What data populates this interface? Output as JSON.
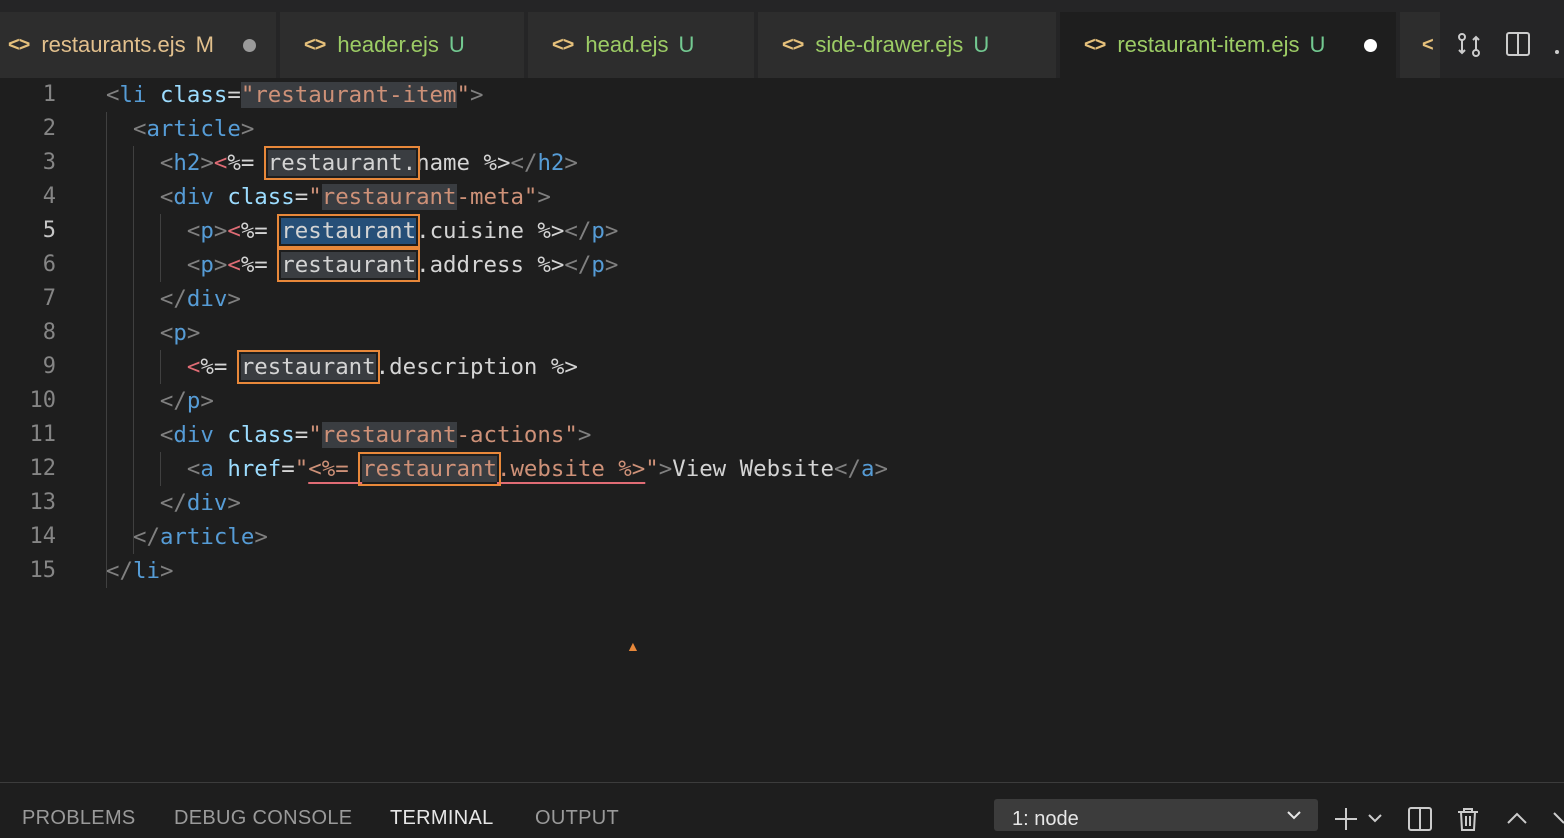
{
  "tabs": [
    {
      "name": "restaurants.ejs",
      "badge": "M",
      "icon": "code-bracket-icon",
      "dirty": true
    },
    {
      "name": "header.ejs",
      "badge": "U",
      "icon": "code-bracket-icon"
    },
    {
      "name": "head.ejs",
      "badge": "U",
      "icon": "code-bracket-icon"
    },
    {
      "name": "side-drawer.ejs",
      "badge": "U",
      "icon": "code-bracket-icon"
    },
    {
      "name": "restaurant-item.ejs",
      "badge": "U",
      "icon": "code-bracket-icon",
      "active": true,
      "dirty": true
    }
  ],
  "tab_icon_glyph": "<>",
  "tab_overflow_glyph": "<",
  "actions": {
    "compare": "compare-changes-icon",
    "split": "split-editor-icon",
    "more": "more-actions-icon"
  },
  "editor": {
    "current_line": 5,
    "line_numbers": [
      "1",
      "2",
      "3",
      "4",
      "5",
      "6",
      "7",
      "8",
      "9",
      "10",
      "11",
      "12",
      "13",
      "14",
      "15"
    ],
    "lines": [
      [
        [
          "tg",
          "<"
        ],
        [
          "tn",
          "li"
        ],
        [
          "tx",
          " "
        ],
        [
          "at",
          "class"
        ],
        [
          "tx",
          "="
        ],
        [
          "st hl",
          "\""
        ],
        [
          "st hl",
          "restaurant-item"
        ],
        [
          "st",
          "\""
        ],
        [
          "tg",
          ">"
        ]
      ],
      [
        [
          "tx",
          "  "
        ],
        [
          "tg",
          "<"
        ],
        [
          "tn",
          "article"
        ],
        [
          "tg",
          ">"
        ]
      ],
      [
        [
          "tx",
          "    "
        ],
        [
          "tg",
          "<"
        ],
        [
          "tn",
          "h2"
        ],
        [
          "tg",
          ">"
        ],
        [
          "ej",
          "<"
        ],
        [
          "tx",
          "%= "
        ],
        [
          "tx hl box",
          "restaurant."
        ],
        [
          "tx",
          "name %>"
        ],
        [
          "tg",
          "</"
        ],
        [
          "tn",
          "h2"
        ],
        [
          "tg",
          ">"
        ]
      ],
      [
        [
          "tx",
          "    "
        ],
        [
          "tg",
          "<"
        ],
        [
          "tn",
          "div"
        ],
        [
          "tx",
          " "
        ],
        [
          "at",
          "class"
        ],
        [
          "tx",
          "="
        ],
        [
          "st",
          "\""
        ],
        [
          "st hl",
          "restaurant"
        ],
        [
          "st",
          "-meta\""
        ],
        [
          "tg",
          ">"
        ]
      ],
      [
        [
          "tx",
          "      "
        ],
        [
          "tg",
          "<"
        ],
        [
          "tn",
          "p"
        ],
        [
          "tg",
          ">"
        ],
        [
          "ej",
          "<"
        ],
        [
          "tx",
          "%= "
        ],
        [
          "tx sel box",
          "restaurant"
        ],
        [
          "tx",
          ".cuisine %>"
        ],
        [
          "tg",
          "</"
        ],
        [
          "tn",
          "p"
        ],
        [
          "tg",
          ">"
        ]
      ],
      [
        [
          "tx",
          "      "
        ],
        [
          "tg",
          "<"
        ],
        [
          "tn",
          "p"
        ],
        [
          "tg",
          ">"
        ],
        [
          "ej",
          "<"
        ],
        [
          "tx",
          "%= "
        ],
        [
          "tx hl box",
          "restaurant"
        ],
        [
          "tx",
          ".address %>"
        ],
        [
          "tg",
          "</"
        ],
        [
          "tn",
          "p"
        ],
        [
          "tg",
          ">"
        ]
      ],
      [
        [
          "tx",
          "    "
        ],
        [
          "tg",
          "</"
        ],
        [
          "tn",
          "div"
        ],
        [
          "tg",
          ">"
        ]
      ],
      [
        [
          "tx",
          "    "
        ],
        [
          "tg",
          "<"
        ],
        [
          "tn",
          "p"
        ],
        [
          "tg",
          ">"
        ]
      ],
      [
        [
          "tx",
          "      "
        ],
        [
          "ej",
          "<"
        ],
        [
          "tx",
          "%= "
        ],
        [
          "tx hl box",
          "restaurant"
        ],
        [
          "tx",
          ".description %>"
        ]
      ],
      [
        [
          "tx",
          "    "
        ],
        [
          "tg",
          "</"
        ],
        [
          "tn",
          "p"
        ],
        [
          "tg",
          ">"
        ]
      ],
      [
        [
          "tx",
          "    "
        ],
        [
          "tg",
          "<"
        ],
        [
          "tn",
          "div"
        ],
        [
          "tx",
          " "
        ],
        [
          "at",
          "class"
        ],
        [
          "tx",
          "="
        ],
        [
          "st",
          "\""
        ],
        [
          "st hl",
          "restaurant"
        ],
        [
          "st",
          "-actions\""
        ],
        [
          "tg",
          ">"
        ]
      ],
      [
        [
          "tx",
          "      "
        ],
        [
          "tg",
          "<"
        ],
        [
          "tn",
          "a"
        ],
        [
          "tx",
          " "
        ],
        [
          "at",
          "href"
        ],
        [
          "tx",
          "="
        ],
        [
          "st",
          "\""
        ],
        [
          "st sq",
          "<%= "
        ],
        [
          "st hl box",
          "restaurant"
        ],
        [
          "st sq",
          ".website %>"
        ],
        [
          "st",
          "\""
        ],
        [
          "tg",
          ">"
        ],
        [
          "tx",
          "View Website"
        ],
        [
          "tg",
          "</"
        ],
        [
          "tn",
          "a"
        ],
        [
          "tg",
          ">"
        ]
      ],
      [
        [
          "tx",
          "    "
        ],
        [
          "tg",
          "</"
        ],
        [
          "tn",
          "div"
        ],
        [
          "tg",
          ">"
        ]
      ],
      [
        [
          "tx",
          "  "
        ],
        [
          "tg",
          "</"
        ],
        [
          "tn",
          "article"
        ],
        [
          "tg",
          ">"
        ]
      ],
      [
        [
          "tg",
          "</"
        ],
        [
          "tn",
          "li"
        ],
        [
          "tg",
          ">"
        ]
      ]
    ]
  },
  "panel": {
    "tabs": [
      "PROBLEMS",
      "DEBUG CONSOLE",
      "TERMINAL",
      "OUTPUT"
    ],
    "active": "TERMINAL",
    "terminal_select": "1: node",
    "icons": [
      "add-terminal-icon",
      "dropdown-icon",
      "split-terminal-icon",
      "trash-icon",
      "maximize-panel-icon",
      "close-panel-icon"
    ]
  },
  "colors": {
    "accent_box": "#e8883a",
    "selection": "#264f78",
    "untracked": "#73c991",
    "modified": "#e2c08d"
  }
}
